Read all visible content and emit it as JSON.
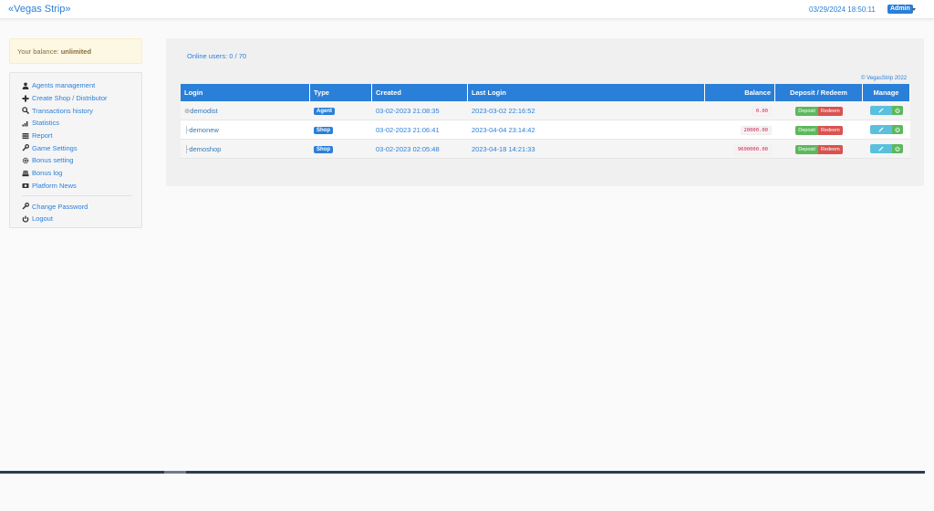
{
  "navbar": {
    "brand": "«Vegas Strip»",
    "datetime": "03/29/2024 18:50:11",
    "user": "Admin"
  },
  "balance": {
    "label": "Your balance:",
    "value": "unlimited"
  },
  "menu": {
    "items": [
      {
        "label": "Agents management",
        "icon": "user-icon"
      },
      {
        "label": "Create Shop / Distributor",
        "icon": "plus-icon"
      },
      {
        "label": "Transactions history",
        "icon": "search-icon"
      },
      {
        "label": "Statistics",
        "icon": "signal-icon"
      },
      {
        "label": "Report",
        "icon": "list-icon"
      },
      {
        "label": "Game Settings",
        "icon": "wrench-icon"
      },
      {
        "label": "Bonus setting",
        "icon": "gear-icon"
      },
      {
        "label": "Bonus log",
        "icon": "stack-icon"
      },
      {
        "label": "Platform News",
        "icon": "camera-icon"
      }
    ],
    "account_items": [
      {
        "label": "Change Password",
        "icon": "wrench-icon"
      },
      {
        "label": "Logout",
        "icon": "power-icon"
      }
    ]
  },
  "content": {
    "online_users": "Online users: 0 / 70",
    "copyright": "© VegasStrip 2022"
  },
  "table": {
    "headers": {
      "login": "Login",
      "type": "Type",
      "created": "Created",
      "last_login": "Last Login",
      "balance": "Balance",
      "deposit_redeem": "Deposit / Redeem",
      "manage": "Manage"
    },
    "deposit_label": "Deposit",
    "redeem_label": "Redeem",
    "rows": [
      {
        "prefix": "⊕",
        "login": "demodist",
        "type": "Agent",
        "created": "03-02-2023 21:08:35",
        "last_login": "2023-03-02 22:16:52",
        "balance": "0.00"
      },
      {
        "prefix": "├",
        "login": "demonew",
        "type": "Shop",
        "created": "03-02-2023 21:06:41",
        "last_login": "2023-04-04 23:14:42",
        "balance": "20000.00"
      },
      {
        "prefix": "├",
        "login": "demoshop",
        "type": "Shop",
        "created": "03-02-2023 02:05:48",
        "last_login": "2023-04-18 14:21:33",
        "balance": "9600000.00"
      }
    ]
  },
  "colors": {
    "primary": "#2a7fd8",
    "success": "#5cb85c",
    "danger": "#d9534f",
    "info": "#5bc0de"
  }
}
